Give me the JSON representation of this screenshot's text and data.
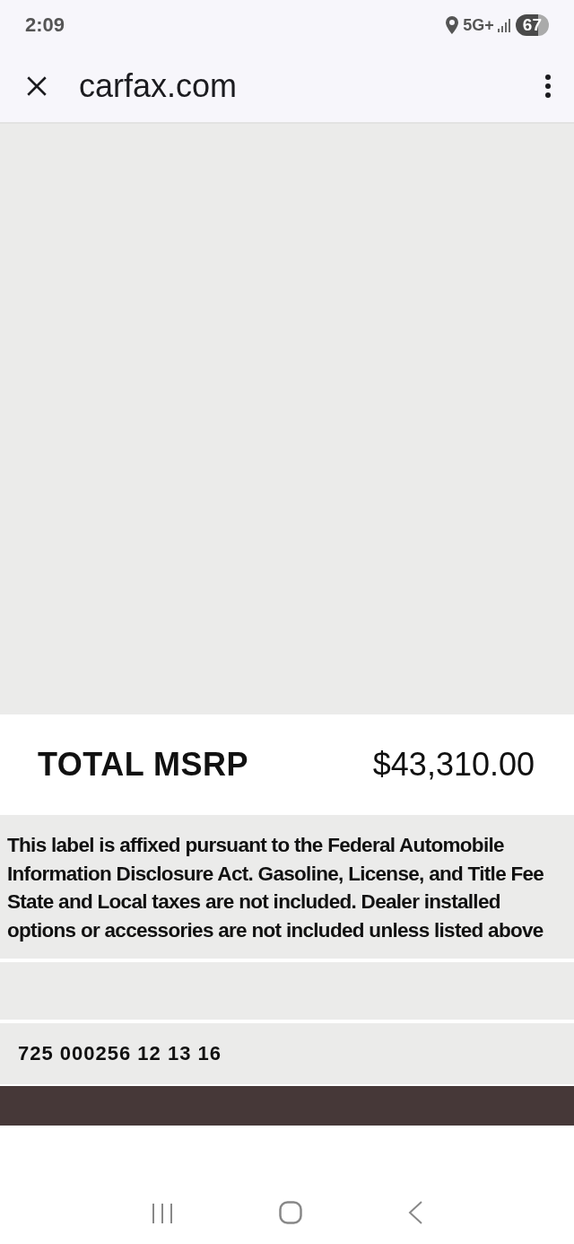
{
  "status_bar": {
    "time": "2:09",
    "network": "5G+",
    "battery": "67"
  },
  "toolbar": {
    "title": "carfax.com"
  },
  "label": {
    "total_label": "TOTAL MSRP",
    "total_value": "$43,310.00",
    "disclosure_lines": [
      "This label is affixed pursuant to the Federal Automobile",
      "Information Disclosure Act.  Gasoline, License, and Title Fee",
      "State and Local taxes are not included.  Dealer installed",
      "options or accessories are  not included unless listed above"
    ],
    "code_line": "725 000256 12 13 16"
  }
}
